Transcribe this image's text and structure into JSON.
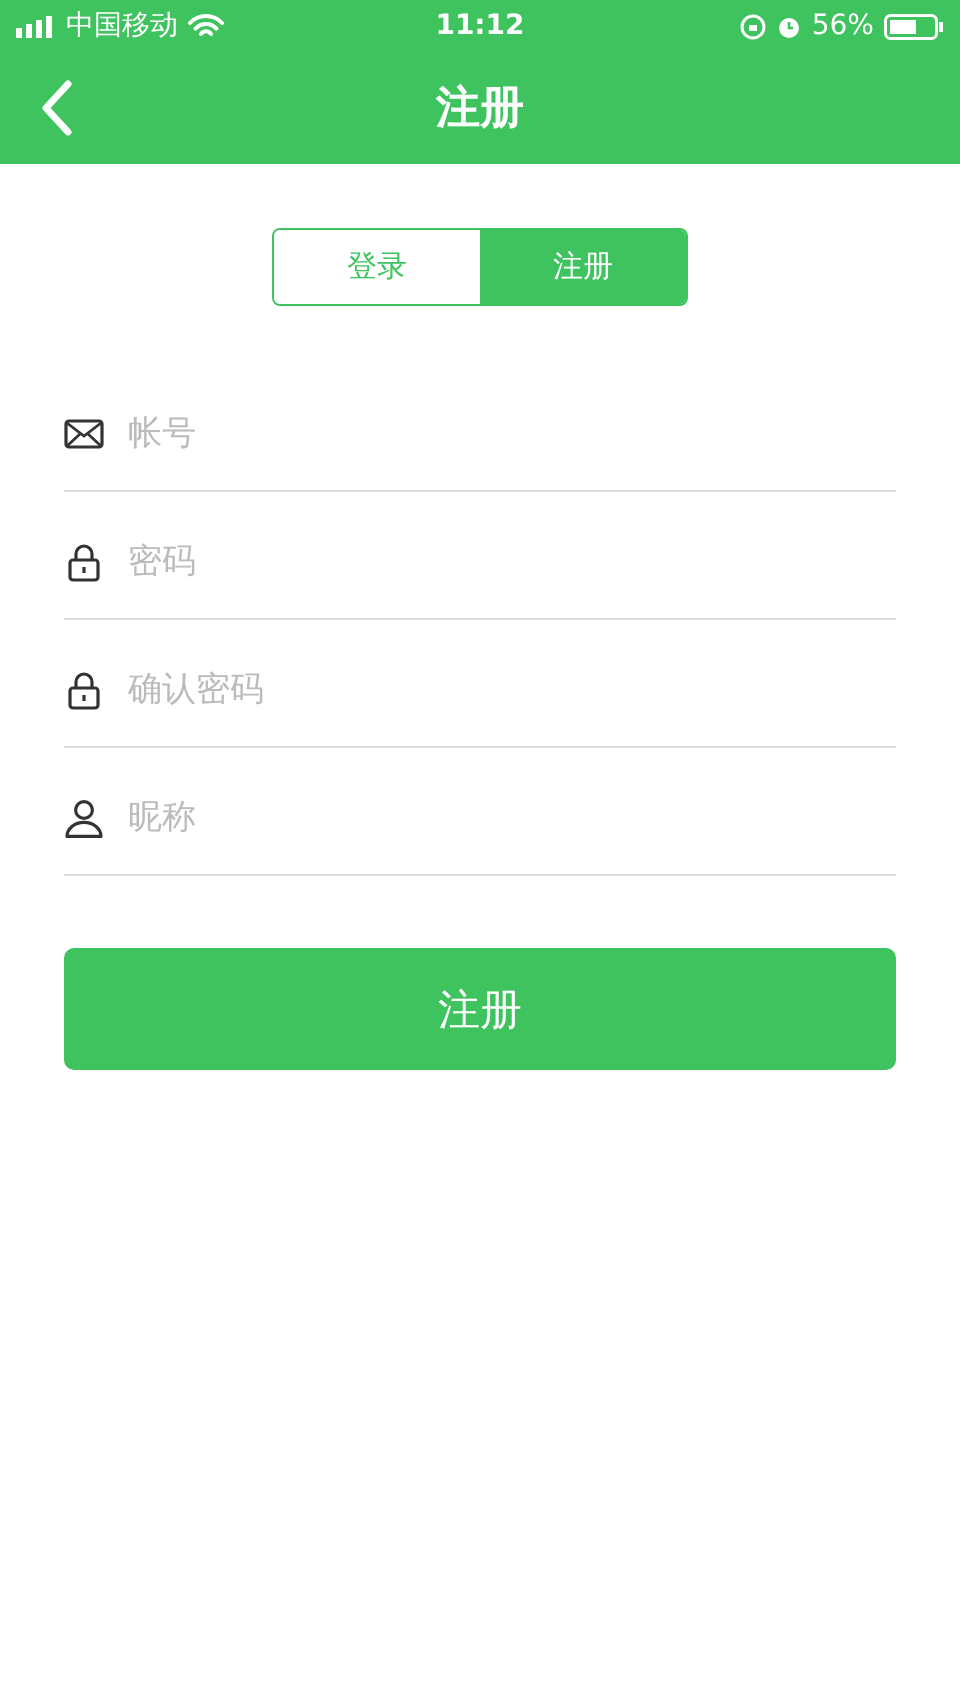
{
  "status_bar": {
    "carrier": "中国移动",
    "time": "11:12",
    "battery": "56%"
  },
  "header": {
    "title": "注册"
  },
  "tabs": [
    {
      "label": "登录",
      "selected": false
    },
    {
      "label": "注册",
      "selected": true
    }
  ],
  "fields": [
    {
      "kind": "mail",
      "placeholder": "帐号"
    },
    {
      "kind": "lock",
      "placeholder": "密码"
    },
    {
      "kind": "lock",
      "placeholder": "确认密码"
    },
    {
      "kind": "user",
      "placeholder": "昵称"
    }
  ],
  "submit": "注册"
}
